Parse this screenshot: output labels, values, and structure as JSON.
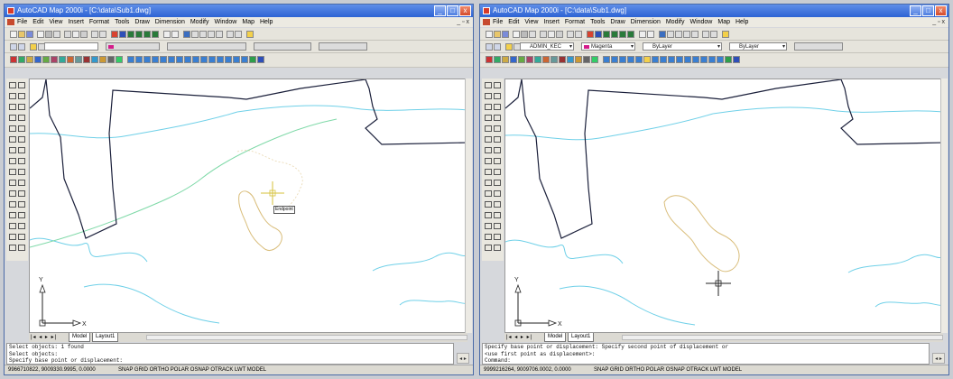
{
  "left_window": {
    "title": "AutoCAD Map 2000i - [C:\\data\\Sub1.dwg]",
    "menu": [
      "File",
      "Edit",
      "View",
      "Insert",
      "Format",
      "Tools",
      "Draw",
      "Dimension",
      "Modify",
      "Window",
      "Map",
      "Help"
    ],
    "layer_name": "",
    "color_name": "",
    "linetype": "",
    "lineweight": "",
    "tab_model": "Model",
    "tab_layout": "Layout1",
    "tooltip": "Endpoint",
    "command_lines": [
      "Select objects: 1 found",
      "Select objects:",
      "Specify base point or displacement:"
    ],
    "coordinates": "9966710822, 9009330.9995, 0.0000",
    "status_modes": "SNAP GRID ORTHO POLAR OSNAP OTRACK LWT MODEL"
  },
  "right_window": {
    "title": "AutoCAD Map 2000i - [C:\\data\\Sub1.dwg]",
    "menu": [
      "File",
      "Edit",
      "View",
      "Insert",
      "Format",
      "Tools",
      "Draw",
      "Dimension",
      "Modify",
      "Window",
      "Map",
      "Help"
    ],
    "layer_name": "ADMIN_KEC",
    "color_name": "Magenta",
    "linetype": "ByLayer",
    "lineweight": "ByLayer",
    "tab_model": "Model",
    "tab_layout": "Layout1",
    "command_lines": [
      "Specify base point or displacement: Specify second point of displacement or",
      "<use first point as displacement>:",
      "Command:"
    ],
    "coordinates": "9999216264, 9009706.0002, 0.0000",
    "status_modes": "SNAP GRID ORTHO POLAR OSNAP OTRACK LWT MODEL"
  },
  "colors": {
    "titlebar": "#2d63d4",
    "boundary": "#1a1f3a",
    "contour": "#6fd0e8",
    "road": "#7fd9a8",
    "parcel": "#d9bd7a",
    "crosshair_yellow": "#d6c23a",
    "crosshair_dark": "#222222"
  },
  "icons": [
    "autocad-app-icon",
    "minimize-icon",
    "maximize-icon",
    "close-icon",
    "draw-tool-icon",
    "modify-tool-icon",
    "ucs-axis-icon"
  ]
}
